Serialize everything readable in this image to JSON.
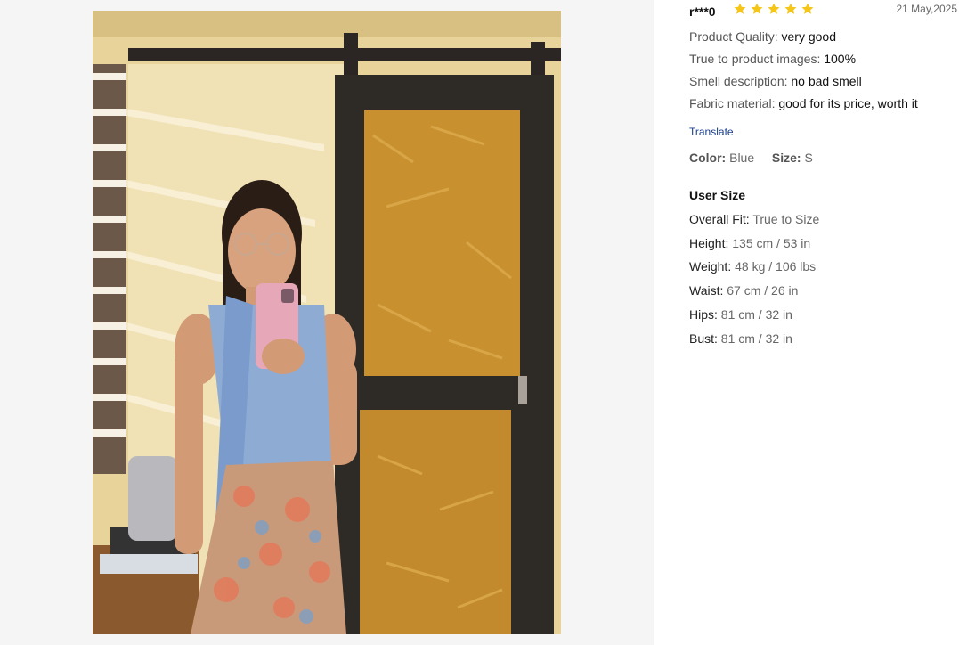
{
  "review": {
    "username": "r***0",
    "rating": 5,
    "rating_max": 5,
    "date": "21 May,2025",
    "attributes": [
      {
        "label": "Product Quality:",
        "value": "very good"
      },
      {
        "label": "True to product images:",
        "value": "100%"
      },
      {
        "label": "Smell description:",
        "value": "no bad smell"
      },
      {
        "label": "Fabric material:",
        "value": "good for its price, worth it"
      }
    ],
    "translate_label": "Translate",
    "color_label": "Color:",
    "color_value": "Blue",
    "size_label": "Size:",
    "size_value": "S",
    "user_size": {
      "title": "User Size",
      "rows": [
        {
          "label": "Overall Fit:",
          "value": "True to Size"
        },
        {
          "label": "Height:",
          "value": "135 cm / 53 in"
        },
        {
          "label": "Weight:",
          "value": "48 kg / 106 lbs"
        },
        {
          "label": "Waist:",
          "value": "67 cm / 26 in"
        },
        {
          "label": "Hips:",
          "value": "81 cm / 32 in"
        },
        {
          "label": "Bust:",
          "value": "81 cm / 32 in"
        }
      ]
    }
  },
  "colors": {
    "star": "#f5c518",
    "link": "#1a3f8f",
    "panel_bg": "#f5f5f5"
  },
  "icons": {
    "star": "star-icon"
  }
}
